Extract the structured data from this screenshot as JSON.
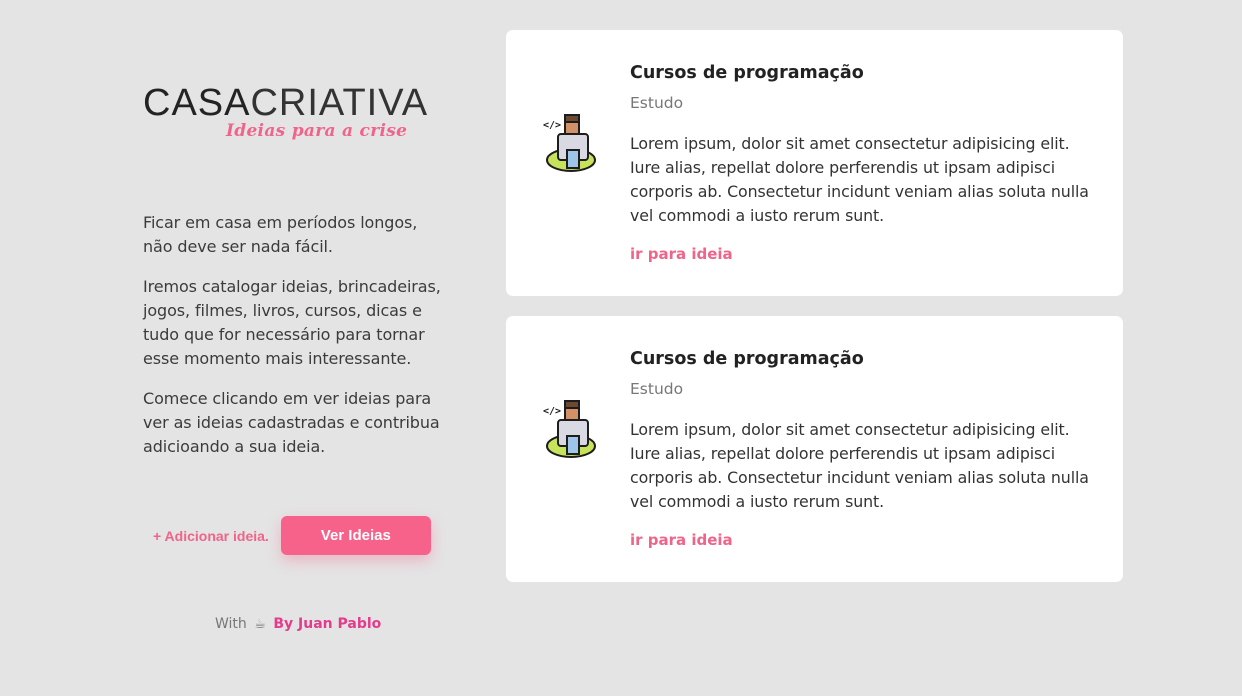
{
  "logo": {
    "part1": "CASA",
    "part2": "CRIATIVA",
    "tagline": "Ideias para a crise"
  },
  "intro": {
    "paragraphs": [
      "Ficar em casa em períodos longos, não deve ser nada fácil.",
      "Iremos catalogar ideias, brincadeiras, jogos, filmes, livros, cursos, dicas e tudo que for necessário para tornar esse momento mais interessante.",
      "Comece clicando em ver ideias para ver as ideias cadastradas e contribua adicioando a sua ideia."
    ]
  },
  "actions": {
    "add_label": "+ Adicionar ideia.",
    "view_label": "Ver Ideias"
  },
  "footer": {
    "prefix": "With",
    "coffee": "☕",
    "author": "By Juan Pablo"
  },
  "cards": [
    {
      "icon": "programmer-icon",
      "title": "Cursos de programação",
      "category": "Estudo",
      "description": "Lorem ipsum, dolor sit amet consectetur adipisicing elit. Iure alias, repellat dolore perferendis ut ipsam adipisci corporis ab. Consectetur incidunt veniam alias soluta nulla vel commodi a iusto rerum sunt.",
      "link_label": "ir para ideia"
    },
    {
      "icon": "programmer-icon",
      "title": "Cursos de programação",
      "category": "Estudo",
      "description": "Lorem ipsum, dolor sit amet consectetur adipisicing elit. Iure alias, repellat dolore perferendis ut ipsam adipisci corporis ab. Consectetur incidunt veniam alias soluta nulla vel commodi a iusto rerum sunt.",
      "link_label": "ir para ideia"
    }
  ],
  "colors": {
    "accent": "#f6628a",
    "author": "#e23c8c",
    "background": "#e4e4e4"
  }
}
